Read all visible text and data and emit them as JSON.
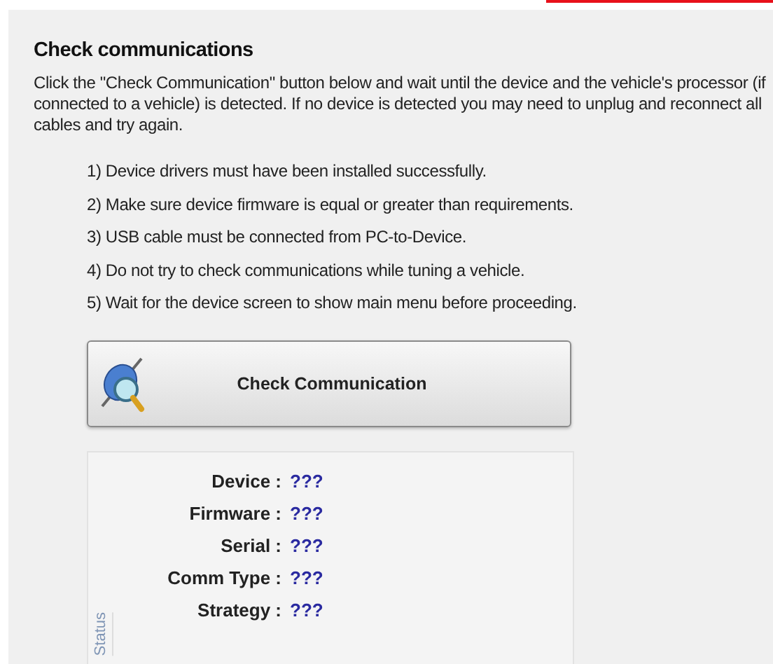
{
  "heading": "Check communications",
  "intro": "Click the \"Check Communication\" button below and wait until the device and the vehicle's processor (if connected to a vehicle) is detected. If no device is detected you may need to unplug and reconnect all cables and try again.",
  "steps": [
    "1) Device drivers must have been installed successfully.",
    "2) Make sure device firmware is equal or greater than requirements.",
    "3) USB cable must be connected from PC-to-Device.",
    "4) Do not try to check communications while tuning a vehicle.",
    "5) Wait for the device screen to show main menu before proceeding."
  ],
  "button": {
    "label": "Check Communication"
  },
  "status": {
    "title": "Status",
    "fields": [
      {
        "label": "Device :",
        "value": "???"
      },
      {
        "label": "Firmware :",
        "value": "???"
      },
      {
        "label": "Serial :",
        "value": "???"
      },
      {
        "label": "Comm Type :",
        "value": "???"
      },
      {
        "label": "Strategy :",
        "value": "???"
      }
    ]
  }
}
